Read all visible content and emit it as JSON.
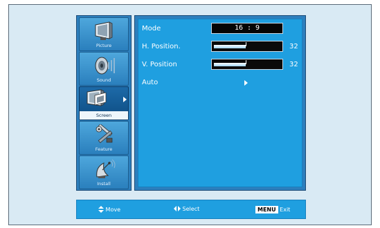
{
  "sidebar": {
    "items": [
      {
        "label": "Picture",
        "icon": "monitor-icon"
      },
      {
        "label": "Sound",
        "icon": "speaker-icon"
      },
      {
        "label": "Screen",
        "icon": "screen-icon"
      },
      {
        "label": "Feature",
        "icon": "tools-icon"
      },
      {
        "label": "Install",
        "icon": "antenna-icon"
      }
    ],
    "active_index": 2
  },
  "menu": {
    "mode": {
      "label": "Mode",
      "value": "16 : 9"
    },
    "h_position": {
      "label": "H. Position.",
      "value": "32",
      "level_percent": 48
    },
    "v_position": {
      "label": "V. Position",
      "value": "32",
      "level_percent": 48
    },
    "auto": {
      "label": "Auto"
    }
  },
  "bottom_bar": {
    "move_label": "Move",
    "select_label": "Select",
    "menu_key": "MENU",
    "exit_label": "Exit"
  },
  "colors": {
    "panel_bg": "#1f9fe0",
    "panel_border": "#2d7fbd",
    "background": "#d9eaf4"
  }
}
